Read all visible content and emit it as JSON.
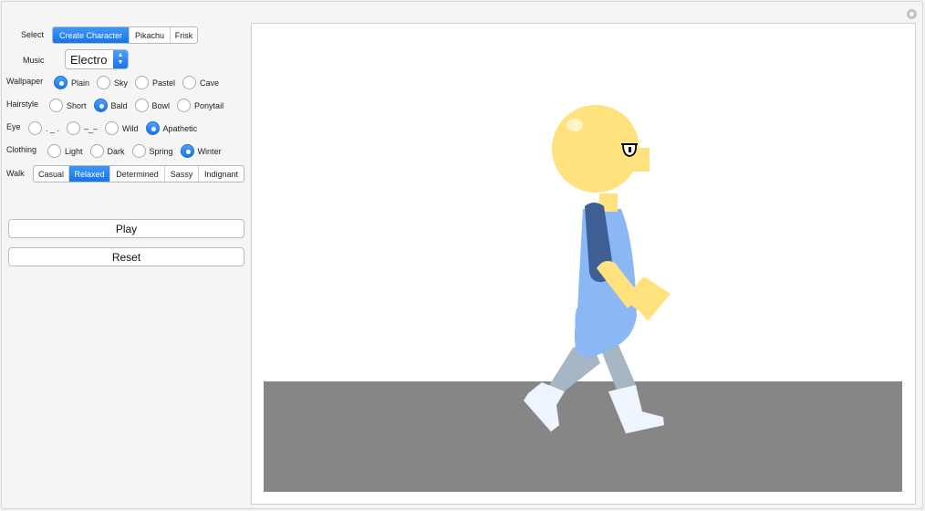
{
  "controls": {
    "select": {
      "label": "Select",
      "options": [
        {
          "label": "Create Character",
          "active": true
        },
        {
          "label": "Pikachu",
          "active": false
        },
        {
          "label": "Frisk",
          "active": false
        }
      ]
    },
    "music": {
      "label": "Music",
      "value": "Electro"
    },
    "wallpaper": {
      "label": "Wallpaper",
      "options": [
        {
          "label": "Plain",
          "checked": true
        },
        {
          "label": "Sky",
          "checked": false
        },
        {
          "label": "Pastel",
          "checked": false
        },
        {
          "label": "Cave",
          "checked": false
        }
      ]
    },
    "hairstyle": {
      "label": "Hairstyle",
      "options": [
        {
          "label": "Short",
          "checked": false
        },
        {
          "label": "Bald",
          "checked": true
        },
        {
          "label": "Bowl",
          "checked": false
        },
        {
          "label": "Ponytail",
          "checked": false
        }
      ]
    },
    "eye": {
      "label": "Eye",
      "options": [
        {
          "label": ". _ .",
          "checked": false
        },
        {
          "label": "–_–",
          "checked": false
        },
        {
          "label": "Wild",
          "checked": false
        },
        {
          "label": "Apathetic",
          "checked": true
        }
      ]
    },
    "clothing": {
      "label": "Clothing",
      "options": [
        {
          "label": "Light",
          "checked": false
        },
        {
          "label": "Dark",
          "checked": false
        },
        {
          "label": "Spring",
          "checked": false
        },
        {
          "label": "Winter",
          "checked": true
        }
      ]
    },
    "walk": {
      "label": "Walk",
      "options": [
        {
          "label": "Casual",
          "active": false
        },
        {
          "label": "Relaxed",
          "active": true
        },
        {
          "label": "Determined",
          "active": false
        },
        {
          "label": "Sassy",
          "active": false
        },
        {
          "label": "Indignant",
          "active": false
        }
      ]
    },
    "play_label": "Play",
    "reset_label": "Reset"
  },
  "colors": {
    "accent": "#1a7cf0",
    "ground": "#868686",
    "skin": "#ffe17d",
    "shirt": "#8bb8f5",
    "sleeve_dark": "#3d5f96",
    "pants": "#a6b6c5",
    "boots": "#eef5fe"
  }
}
